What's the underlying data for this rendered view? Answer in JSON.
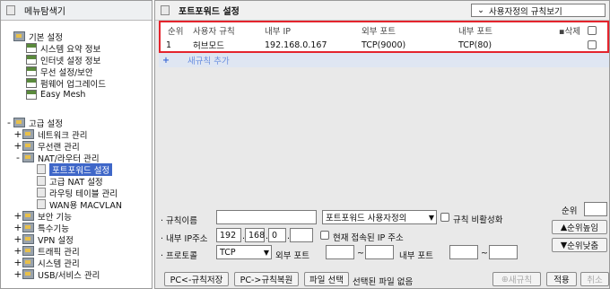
{
  "sidebar": {
    "title": "메뉴탐색기",
    "basic": {
      "label": "기본 설정",
      "items": [
        "시스템 요약 정보",
        "인터넷 설정 정보",
        "무선 설정/보안",
        "펌웨어 업그레이드",
        "Easy Mesh"
      ]
    },
    "advanced": {
      "label": "고급 설정",
      "items": [
        {
          "label": "네트워크 관리",
          "toggle": "+"
        },
        {
          "label": "무선랜 관리",
          "toggle": "+"
        },
        {
          "label": "NAT/라우터 관리",
          "toggle": "-"
        }
      ],
      "nat_children": [
        "포트포워드 설정",
        "고급 NAT 설정",
        "라우팅 테이블 관리",
        "WAN용 MACVLAN"
      ],
      "more": [
        "보안 기능",
        "특수기능",
        "VPN 설정",
        "트래픽 관리",
        "시스템 관리",
        "USB/서비스 관리"
      ]
    }
  },
  "main": {
    "title": "포트포워드 설정",
    "view_select": "사용자정의 규칙보기",
    "table": {
      "headers": {
        "order": "순위",
        "rule": "사용자 규칙",
        "internal_ip": "내부 IP",
        "external_port": "외부 포트",
        "internal_port": "내부 포트",
        "delete": "삭제"
      },
      "rows": [
        {
          "order": "1",
          "rule": "허브모드",
          "internal_ip": "192.168.0.167",
          "external_port": "TCP(9000)",
          "internal_port": "TCP(80)"
        }
      ]
    },
    "add_rule": "새규칙 추가",
    "form": {
      "rule_name_label": "· 규칙이름",
      "rule_name_value": "",
      "rule_type": "포트포워드 사용자정의",
      "disable_label": "규칙 비활성화",
      "internal_ip_label": "· 내부 IP주소",
      "ip": [
        "192",
        "168",
        "0",
        ""
      ],
      "current_ip_label": "현재 접속된 IP 주소",
      "protocol_label": "· 프로토콜",
      "protocol": "TCP",
      "external_port_label": "외부 포트",
      "internal_port_label": "내부 포트",
      "tilde": "~",
      "order_label": "순위",
      "order_up": "순위높임",
      "order_down": "순위낮춤",
      "save_pc": "PC<-규칙저장",
      "restore_pc": "PC->규칙복원",
      "file_select": "파일 선택",
      "no_file": "선택된 파일 없음",
      "new_rule": "새규칙",
      "apply": "적용",
      "cancel": "취소"
    }
  }
}
